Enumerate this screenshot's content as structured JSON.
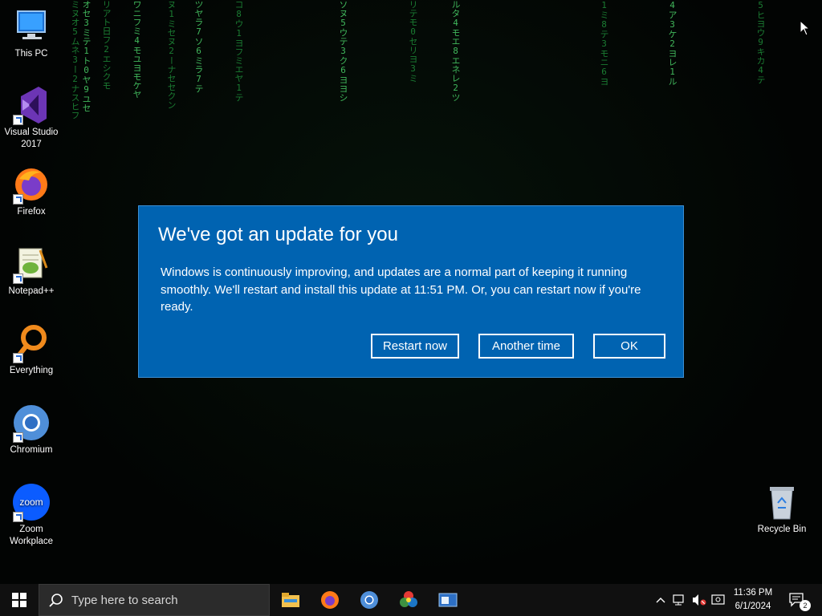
{
  "desktop": {
    "icons": [
      {
        "label": "This PC",
        "icon": "computer-icon"
      },
      {
        "label": "Visual Studio 2017",
        "icon": "visual-studio-icon"
      },
      {
        "label": "Firefox",
        "icon": "firefox-icon"
      },
      {
        "label": "Notepad++",
        "icon": "notepad-plus-plus-icon"
      },
      {
        "label": "Everything",
        "icon": "everything-search-icon"
      },
      {
        "label": "Chromium",
        "icon": "chromium-icon"
      },
      {
        "label": "Zoom Workplace",
        "icon": "zoom-icon",
        "logo_text": "zoom"
      },
      {
        "label": "Recycle Bin",
        "icon": "recycle-bin-icon"
      }
    ],
    "wallpaper": {
      "style": "matrix-digital-rain",
      "columns": [
        "ミヌオ5ムネ3ー2ナスヒフ",
        "オセ3ミテ1ト0ヤ9ユセ",
        "リアト日フ2エシクモ",
        "ワニフミ4モユヨモケヤ",
        "ヌ1ミセヌ2ーナセセクン",
        "ツヤラ7ソ6ミラ7テ",
        "コ8ウ1ヨフミエヤ1テ",
        "ソヌ5ウテ3ク6ヨヨシ",
        "リテモ0セリヨ3ミ",
        "ルタ4モエ8エネレ2ツ",
        "1ミ8テ3モニ6ヨ",
        "4ア3ケ2ヨレ1ル",
        "5ヒヨウ9キカ4テ"
      ],
      "accent_colors": {
        "dim": "#1f8f3a",
        "bright": "#4bd46a"
      }
    }
  },
  "dialog": {
    "title": "We've got an update for you",
    "body": "Windows is continuously improving, and updates are a normal part of keeping it running smoothly. We'll restart and install this update at 11:51 PM. Or, you can restart now if you're ready.",
    "buttons": {
      "restart": "Restart now",
      "another": "Another time",
      "ok": "OK"
    },
    "background_color": "#0063b1"
  },
  "taskbar": {
    "search_placeholder": "Type here to search",
    "pinned": [
      {
        "name": "File Explorer",
        "icon": "file-explorer-icon"
      },
      {
        "name": "Firefox",
        "icon": "firefox-icon"
      },
      {
        "name": "Chromium",
        "icon": "chromium-icon"
      },
      {
        "name": "Color app",
        "icon": "color-wheel-icon"
      },
      {
        "name": "Window app",
        "icon": "window-app-icon"
      }
    ],
    "tray": {
      "time": "11:36 PM",
      "date": "6/1/2024",
      "notification_count": "2"
    }
  }
}
